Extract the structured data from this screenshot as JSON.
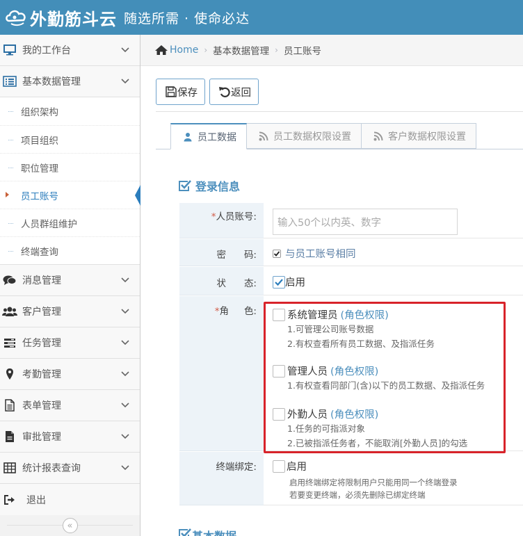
{
  "header": {
    "brand": "外勤筋斗云",
    "slogan": "随选所需 · 使命必达",
    "bg_color": "#438eb9"
  },
  "sidebar": {
    "top_items": [
      {
        "label": "我的工作台",
        "icon": "monitor-icon"
      },
      {
        "label": "基本数据管理",
        "icon": "list-icon"
      }
    ],
    "sub_items": [
      {
        "label": "组织架构"
      },
      {
        "label": "项目组织"
      },
      {
        "label": "职位管理"
      },
      {
        "label": "员工账号",
        "active": true
      },
      {
        "label": "人员群组维护"
      },
      {
        "label": "终端查询"
      }
    ],
    "bottom_items": [
      {
        "label": "消息管理",
        "icon": "comments-icon"
      },
      {
        "label": "客户管理",
        "icon": "users-icon"
      },
      {
        "label": "任务管理",
        "icon": "tasks-icon"
      },
      {
        "label": "考勤管理",
        "icon": "map-marker-icon"
      },
      {
        "label": "表单管理",
        "icon": "file-text-icon"
      },
      {
        "label": "审批管理",
        "icon": "file-icon"
      },
      {
        "label": "统计报表查询",
        "icon": "table-icon"
      },
      {
        "label": "退出",
        "icon": "sign-out-icon"
      }
    ],
    "collapse_glyph": "«"
  },
  "breadcrumb": {
    "home": "Home",
    "sep": "›",
    "level1": "基本数据管理",
    "level2": "员工账号"
  },
  "toolbar": {
    "save_label": "保存",
    "back_label": "返回"
  },
  "tabs": [
    {
      "label": "员工数据",
      "icon": "user-icon",
      "active": true
    },
    {
      "label": "员工数据权限设置",
      "icon": "rss-icon"
    },
    {
      "label": "客户数据权限设置",
      "icon": "rss-icon"
    }
  ],
  "login_section": {
    "title": "登录信息",
    "account": {
      "required_mark": "*",
      "label": "人员账号:",
      "placeholder": "输入50个以内英、数字"
    },
    "password": {
      "label_1": "密",
      "label_2": "码:",
      "option": "与员工账号相同",
      "checked": true
    },
    "status": {
      "label_1": "状",
      "label_2": "态:",
      "option": "启用",
      "checked": true
    },
    "role": {
      "required_mark": "*",
      "label_1": "角",
      "label_2": "色:",
      "options": [
        {
          "name": "系统管理员",
          "link": "(角色权限)",
          "desc": [
            "1.可管理公司账号数据",
            "2.有权查看所有员工数据、及指派任务"
          ]
        },
        {
          "name": "管理人员",
          "link": "(角色权限)",
          "desc": [
            "1.有权查看同部门(含)以下的员工数据、及指派任务"
          ]
        },
        {
          "name": "外勤人员",
          "link": "(角色权限)",
          "desc": [
            "1.任务的可指派对象",
            "2.已被指派任务者，不能取消[外勤人员]的勾选"
          ]
        }
      ],
      "highlight_color": "#d8232a"
    },
    "terminal": {
      "label": "终端绑定:",
      "option": "启用",
      "checked": false,
      "hint_1": "启用终端绑定将限制用户只能用同一个终端登录",
      "hint_2": "若要变更终端，必须先删除已绑定终端"
    }
  },
  "basic_section": {
    "title": "基本数据"
  }
}
